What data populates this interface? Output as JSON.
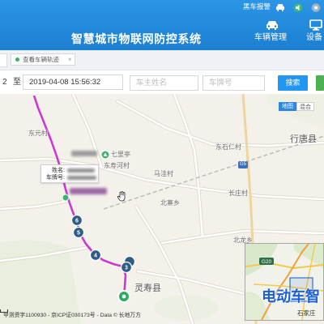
{
  "header": {
    "title": "智慧城市物联网防控系统",
    "alarm_label": "黑车报警",
    "status_icons": [
      "car-icon",
      "speaker-icon",
      "settings-icon"
    ],
    "nav": [
      {
        "label": "车辆管理",
        "icon": "car-icon"
      },
      {
        "label": "设备",
        "icon": "device-icon"
      }
    ],
    "colors": {
      "background": "#1d80d3",
      "text": "#ffffff"
    }
  },
  "tabs": {
    "items": [
      {
        "label": "查看车辆轨迹",
        "close_icon": "×",
        "active": true,
        "status_color": "#34b366"
      }
    ]
  },
  "search": {
    "start_time_fragment": "2",
    "range_separator": "至",
    "end_time": "2019-04-08 15:56:32",
    "owner_placeholder": "车主姓名",
    "plate_placeholder": "车牌号",
    "search_label": "搜索",
    "search_color": "#2196f3",
    "extra_button_color": "#4caf50"
  },
  "map": {
    "type_buttons": [
      {
        "label": "地图",
        "active": true
      },
      {
        "label": "混合",
        "active": false
      }
    ],
    "labels": [
      "东元村",
      "七里亭",
      "东寿河村",
      "马洼村",
      "东石仁村",
      "行唐县",
      "长庄村",
      "北寨乡",
      "北龙乡",
      "灵寿县"
    ],
    "road_shield": "G5",
    "track_color": "#c93ad2",
    "track_markers": [
      "6",
      "5",
      "4",
      "3"
    ],
    "popup": {
      "name_label": "姓名:",
      "plate_label": "车牌号:"
    },
    "copyright": "甲测资字1100930 - 京ICP证030173号 - Data © 长地万方",
    "overview": {
      "road_shield": "G20",
      "city_label": "石家庄"
    }
  },
  "watermark": "电动车智"
}
